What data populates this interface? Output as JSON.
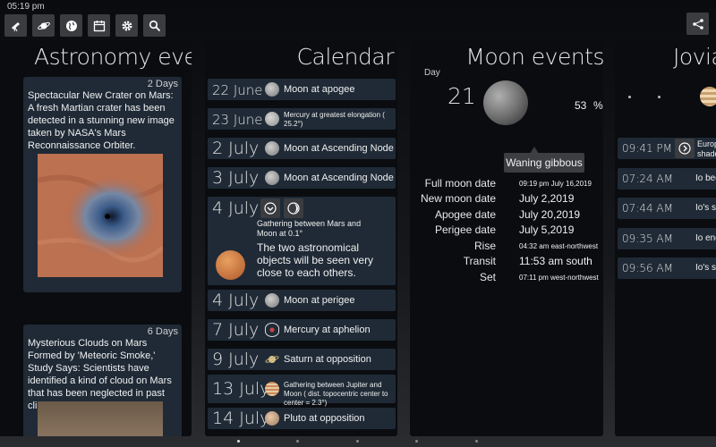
{
  "status": {
    "time": "05:19 pm"
  },
  "toolbar": {
    "icons": [
      "telescope-icon",
      "planet-icon",
      "globe-icon",
      "calendar-icon",
      "gear-icon",
      "search-icon"
    ]
  },
  "astro": {
    "title": "Astronomy events",
    "news": [
      {
        "days": "2 Days",
        "text": "Spectacular New Crater on Mars: A fresh Martian crater has been detected in a stunning new image taken by NASA's Mars Reconnaissance Orbiter."
      },
      {
        "days": "6 Days",
        "text": "Mysterious Clouds on Mars Formed by 'Meteoric Smoke,' Study Says: Scientists have identified a kind of cloud on Mars that has been neglected in past climate models."
      }
    ]
  },
  "calendar": {
    "title": "Calendar",
    "rows": [
      {
        "date": "22 June",
        "event": "Moon at apogee"
      },
      {
        "date": "23 June",
        "event": "Mercury at greatest elongation ( 25.2°)"
      },
      {
        "date": "2 July",
        "event": "Moon at Ascending Node"
      },
      {
        "date": "3 July",
        "event": "Moon at Ascending Node"
      },
      {
        "date": "4 July",
        "event": "Gathering between Mars and Moon at 0.1°",
        "detail": "The two astronomical objects will be seen very close to each others."
      },
      {
        "date": "4 July",
        "event": "Moon at perigee"
      },
      {
        "date": "7 July",
        "event": "Mercury at aphelion"
      },
      {
        "date": "9 July",
        "event": "Saturn at opposition"
      },
      {
        "date": "13 July",
        "event": "Gathering between Jupiter and Moon ( dist. topocentric center to center = 2.3°)"
      },
      {
        "date": "14 July",
        "event": "Pluto at opposition"
      }
    ]
  },
  "moon": {
    "title": "Moon events",
    "day_label": "Day",
    "day": "21",
    "illumination": "53",
    "percent_sign": "%",
    "phase": "Waning gibbous",
    "rows": [
      {
        "label": "Full moon date",
        "value": "09:19 pm July 16,2019"
      },
      {
        "label": "New moon date",
        "value": "July 2,2019"
      },
      {
        "label": "Apogee date",
        "value": "July 20,2019"
      },
      {
        "label": "Perigee date",
        "value": "July 5,2019"
      },
      {
        "label": "Rise",
        "value": "04:32 am east-northwest"
      },
      {
        "label": "Transit",
        "value": "11:53 am south"
      },
      {
        "label": "Set",
        "value": "07:11 pm west-northwest"
      }
    ]
  },
  "jovian": {
    "title": "Jovian",
    "rows": [
      {
        "time": "09:41 PM",
        "event": "Europa's shadow"
      },
      {
        "time": "07:24 AM",
        "event": "Io begins"
      },
      {
        "time": "07:44 AM",
        "event": "Io's shadow"
      },
      {
        "time": "09:35 AM",
        "event": "Io ends"
      },
      {
        "time": "09:56 AM",
        "event": "Io's shadow"
      }
    ]
  },
  "pager": {
    "count": 5,
    "active": 0
  }
}
